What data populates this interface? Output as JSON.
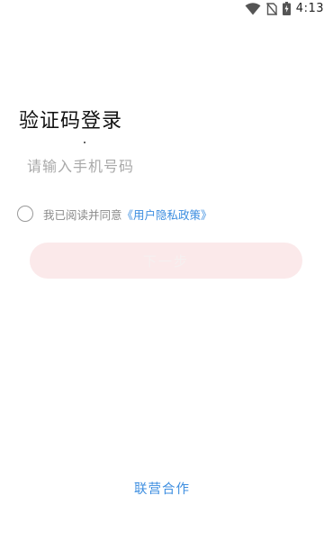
{
  "status_bar": {
    "time": "4:13",
    "icons": [
      "wifi-icon",
      "no-sim-icon",
      "battery-charging-icon"
    ]
  },
  "title": "验证码登录",
  "phone_input": {
    "placeholder": "请输入手机号码",
    "value": ""
  },
  "agreement": {
    "checked": false,
    "text": "我已阅读并同意",
    "link": "《用户隐私政策》"
  },
  "next_button": {
    "label": "下一步",
    "enabled": false
  },
  "footer": {
    "link": "联营合作"
  },
  "colors": {
    "accent_link": "#3d8ee0",
    "button_disabled_bg": "#fbe9ea",
    "placeholder": "#a9a9a9"
  }
}
